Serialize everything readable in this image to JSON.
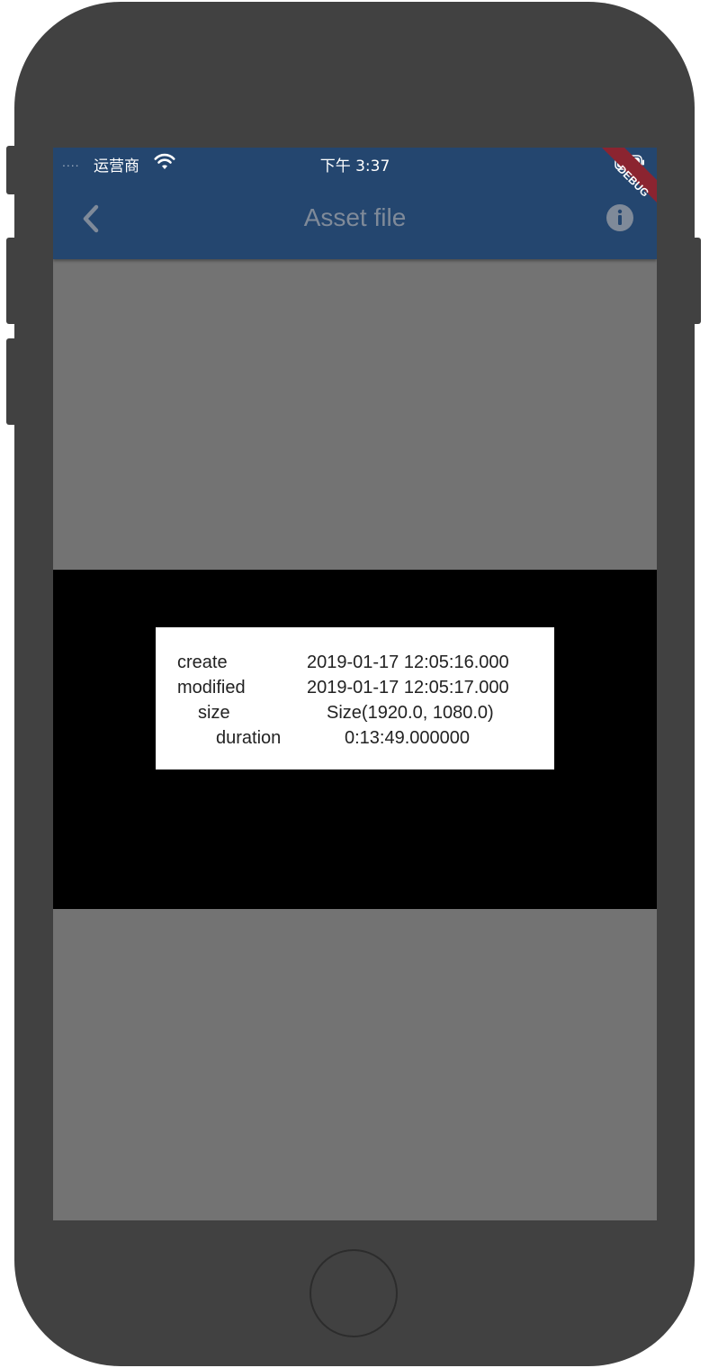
{
  "status_bar": {
    "signal": "....",
    "carrier": "运营商",
    "time": "下午 3:37"
  },
  "app_bar": {
    "title": "Asset file",
    "back_icon": "chevron-left-icon",
    "info_icon": "info-icon"
  },
  "debug_banner": "DEBUG",
  "asset_info": {
    "rows": [
      {
        "label": "create",
        "value": "2019-01-17 12:05:16.000"
      },
      {
        "label": "modified",
        "value": "2019-01-17 12:05:17.000"
      },
      {
        "label": "size",
        "value": "Size(1920.0, 1080.0)"
      },
      {
        "label": "duration",
        "value": "0:13:49.000000"
      }
    ]
  },
  "colors": {
    "app_bar": "#24466f",
    "background": "#737373",
    "video": "#000000",
    "banner": "#8b2430"
  }
}
